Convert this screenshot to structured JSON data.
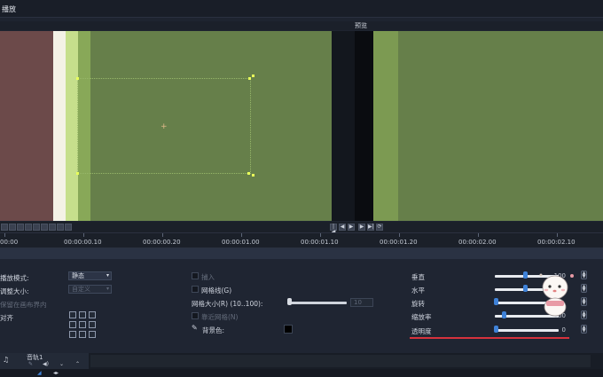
{
  "title": "播放",
  "preview_label": "预览",
  "timeline": {
    "times": [
      "00:00",
      "00:00:00.10",
      "00:00:00.20",
      "00:00:01.00",
      "00:00:01.10",
      "00:00:01.20",
      "00:00:02.00",
      "00:00:02.10"
    ]
  },
  "props": {
    "display_mode_label": "播放模式:",
    "display_mode_value": "静态",
    "size_label": "调整大小:",
    "size_value": "自定义",
    "keep_in_bounds_label": "保留在画布界内",
    "align_label": "对齐",
    "snap_label": "捕入",
    "gridlines_label": "网格线(G)",
    "grid_size_label": "网格大小(R) (10..100):",
    "grid_size_value": "10",
    "near_grid_label": "靠近网格(N)",
    "bg_color_label": "背景色:"
  },
  "params": {
    "vertical": {
      "label": "垂直",
      "value": "100"
    },
    "horizontal": {
      "label": "水平",
      "value": ""
    },
    "rotate": {
      "label": "旋转",
      "value": ""
    },
    "zoom": {
      "label": "缩放率",
      "value": "100"
    },
    "opacity": {
      "label": "透明度",
      "value": "0"
    }
  },
  "track": {
    "name": "音轨1"
  },
  "colors": {
    "accent": "#3f82d8",
    "underline": "#d6323d",
    "preview_green": "#667f4a",
    "preview_brown": "#6c4a4a"
  }
}
